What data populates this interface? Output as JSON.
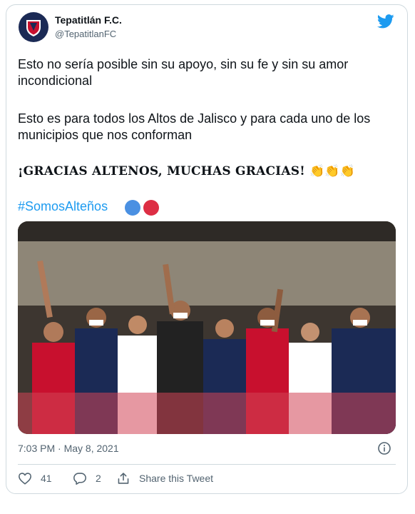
{
  "tweet": {
    "author_name": "Tepatitlán F.C.",
    "author_handle": "@TepatitlanFC",
    "paragraph_1": "Esto no sería posible sin su apoyo, sin su fe y sin su amor incondicional",
    "paragraph_2": "Esto es para todos los Altos de Jalisco y para cada uno de los municipios que nos conforman",
    "paragraph_3": "¡GRACIAS ALTENOS, MUCHAS GRACIAS!",
    "claps": "👏👏👏",
    "hashtag": "#SomosAlteños",
    "timestamp": "7:03 PM · May 8, 2021",
    "likes": "41",
    "replies": "2",
    "share_label": "Share this Tweet"
  },
  "icons": {
    "brand": "twitter-bird-icon",
    "like": "heart-icon",
    "reply": "speech-bubble-icon",
    "share": "share-icon",
    "info": "info-icon"
  },
  "colors": {
    "accent": "#1d9bf0",
    "text": "#0f1419",
    "muted": "#536471",
    "border": "#cfd9de",
    "circle_blue": "#4a90e2",
    "circle_red": "#dd2e44"
  }
}
